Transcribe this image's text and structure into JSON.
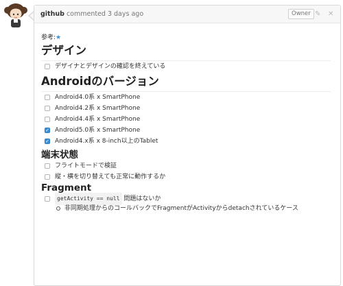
{
  "comment": {
    "author": "github",
    "meta": "commented 3 days ago",
    "badge": "Owner",
    "edit_icon": "pencil-icon",
    "delete_icon": "close-icon"
  },
  "body": {
    "ref_label": "参考:",
    "ref_icon": "★",
    "sections": {
      "design_title": "デザイン",
      "design_tasks": [
        {
          "label": "デザイナとデザインの確認を終えている",
          "checked": false
        }
      ],
      "android_title": "Androidのバージョン",
      "android_tasks": [
        {
          "label": "Android4.0系 x SmartPhone",
          "checked": false
        },
        {
          "label": "Android4.2系 x SmartPhone",
          "checked": false
        },
        {
          "label": "Android4.4系 x SmartPhone",
          "checked": false
        },
        {
          "label": "Android5.0系 x SmartPhone",
          "checked": true
        },
        {
          "label": "Android4.x系 x 8-inch以上のTablet",
          "checked": true
        }
      ],
      "device_title": "端末状態",
      "device_tasks": [
        {
          "label": "フライトモードで検証",
          "checked": false
        },
        {
          "label": "縦・横を切り替えても正常に動作するか",
          "checked": false
        }
      ],
      "fragment_title": "Fragment",
      "fragment_task": {
        "code": "getActivity == null",
        "label": "問題はないか",
        "checked": false,
        "sub": "非同期処理からのコールバックでFragmentがActivityからdetachされているケース"
      }
    }
  }
}
